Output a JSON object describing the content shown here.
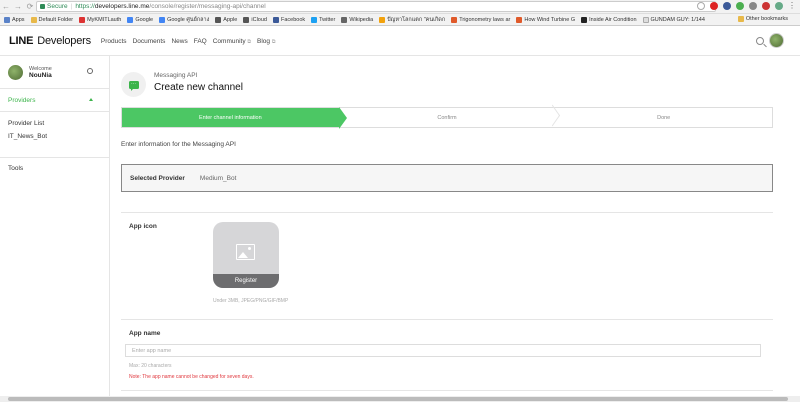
{
  "browser": {
    "secure_label": "Secure",
    "url_scheme": "https://",
    "url_host": "developers.line.me",
    "url_path": "/console/register/messaging-api/channel",
    "bookmarks": [
      {
        "label": "Apps",
        "color": "#5a82c8"
      },
      {
        "label": "Default Folder",
        "color": "#e8b94a"
      },
      {
        "label": "MyKMITLauth",
        "color": "#d33"
      },
      {
        "label": "Google",
        "color": "#4285f4"
      },
      {
        "label": "Google ศูนย์กลาง",
        "color": "#4285f4"
      },
      {
        "label": "Apple",
        "color": "#555"
      },
      {
        "label": "iCloud",
        "color": "#555"
      },
      {
        "label": "Facebook",
        "color": "#3b5998"
      },
      {
        "label": "Twitter",
        "color": "#1da1f2"
      },
      {
        "label": "Wikipedia",
        "color": "#666"
      },
      {
        "label": "ปัญหาโลกแตก \"คนเกิดก",
        "color": "#f2a20d"
      },
      {
        "label": "Trigonometry laws ar",
        "color": "#e05a2a"
      },
      {
        "label": "How Wind Turbine G",
        "color": "#e05a2a"
      },
      {
        "label": "Inside Air Condition",
        "color": "#222"
      },
      {
        "label": "GUNDAM GUY: 1/144",
        "color": "#ddd"
      }
    ],
    "other_bookmarks": "Other bookmarks"
  },
  "header": {
    "logo_line": "LINE",
    "logo_developers": "Developers",
    "nav": [
      "Products",
      "Documents",
      "News",
      "FAQ",
      "Community",
      "Blog"
    ]
  },
  "sidebar": {
    "welcome": "Welcome",
    "username": "NouNia",
    "providers_label": "Providers",
    "items": [
      "Provider List",
      "IT_News_Bot"
    ],
    "tools": "Tools"
  },
  "main": {
    "subtitle": "Messaging API",
    "title": "Create new channel",
    "steps": [
      "Enter channel information",
      "Confirm",
      "Done"
    ],
    "intro": "Enter information for the Messaging API",
    "selected_provider_label": "Selected Provider",
    "selected_provider_value": "Medium_Bot",
    "app_icon_label": "App icon",
    "register_label": "Register",
    "icon_hint": "Under 3MB, JPEG/PNG/GIF/BMP",
    "app_name_label": "App name",
    "app_name_placeholder": "Enter app name",
    "app_name_value": "",
    "max_hint": "Max: 20 characters",
    "warning": "Note: The app name cannot be changed for seven days."
  },
  "colors": {
    "accent_green": "#4cc764",
    "warning_red": "#e0383e"
  }
}
